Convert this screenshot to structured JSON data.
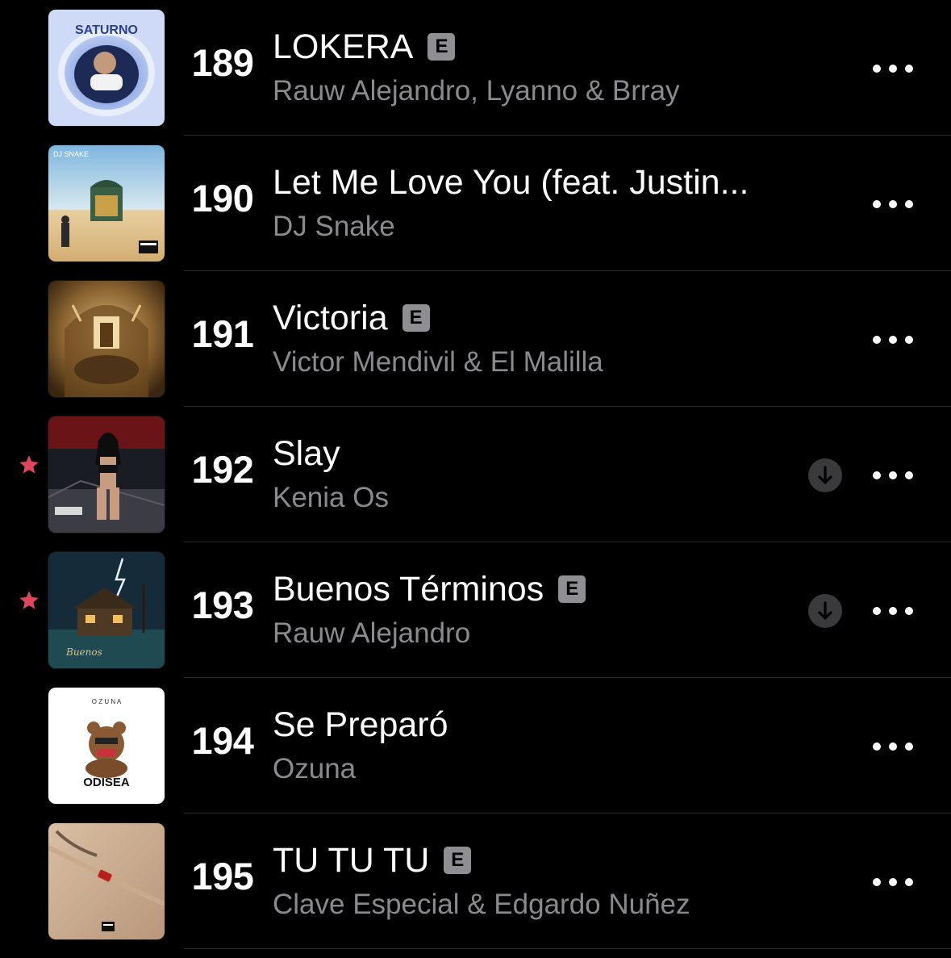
{
  "rows": [
    {
      "rank": "189",
      "title": "LOKERA",
      "artist": "Rauw Alejandro, Lyanno & Brray",
      "explicit": "E",
      "favorited": false,
      "downloadable": false
    },
    {
      "rank": "190",
      "title": "Let Me Love You (feat. Justin...",
      "artist": "DJ Snake",
      "explicit": "",
      "favorited": false,
      "downloadable": false
    },
    {
      "rank": "191",
      "title": "Victoria",
      "artist": "Victor Mendivil & El Malilla",
      "explicit": "E",
      "favorited": false,
      "downloadable": false
    },
    {
      "rank": "192",
      "title": "Slay",
      "artist": "Kenia Os",
      "explicit": "",
      "favorited": true,
      "downloadable": true
    },
    {
      "rank": "193",
      "title": "Buenos Términos",
      "artist": "Rauw Alejandro",
      "explicit": "E",
      "favorited": true,
      "downloadable": true
    },
    {
      "rank": "194",
      "title": "Se Preparó",
      "artist": "Ozuna",
      "explicit": "",
      "favorited": false,
      "downloadable": false
    },
    {
      "rank": "195",
      "title": "TU TU TU",
      "artist": "Clave Especial & Edgardo Nuñez",
      "explicit": "E",
      "favorited": false,
      "downloadable": false
    }
  ],
  "colors": {
    "favorite_star": "#e0475e",
    "secondary_text": "#8a8a8e",
    "explicit_badge": "#8e8e93"
  },
  "icons": {
    "favorite": "star-icon",
    "download": "download-arrow-icon",
    "more": "ellipsis-icon"
  }
}
